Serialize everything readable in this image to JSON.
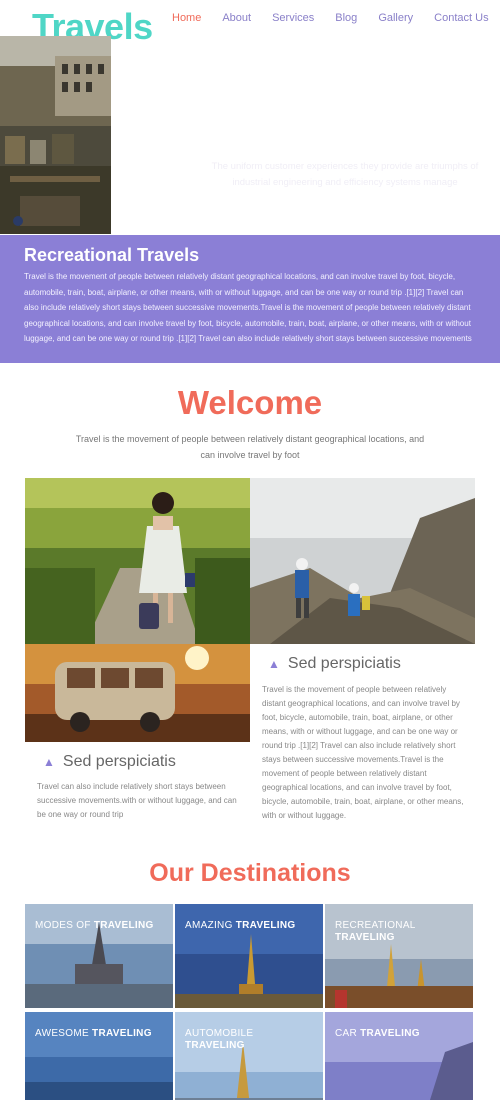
{
  "brand": {
    "logo": "Travels"
  },
  "nav": {
    "items": [
      "Home",
      "About",
      "Services",
      "Blog",
      "Gallery",
      "Contact Us"
    ],
    "active": "Home"
  },
  "hero": {
    "text": "The uniform customer experiences they provide are triumphs of industrial engineering and efficiency systems manage"
  },
  "band": {
    "title": "Recreational Travels",
    "text": "Travel is the movement of people between relatively distant geographical locations, and can involve travel by foot, bicycle, automobile, train, boat, airplane, or other means, with or without luggage, and can be one way or round trip .[1][2] Travel can also include relatively short stays between successive movements.Travel is the movement of people between relatively distant geographical locations, and can involve travel by foot, bicycle, automobile, train, boat, airplane, or other means, with or without luggage, and can be one way or round trip .[1][2] Travel can also include relatively short stays between successive movements"
  },
  "welcome": {
    "title": "Welcome",
    "text": "Travel is the movement of people between relatively distant geographical locations, and can involve travel by foot"
  },
  "features": [
    {
      "title": "Sed perspiciatis",
      "text": "Travel is the movement of people between relatively distant geographical locations, and can involve travel by foot, bicycle, automobile, train, boat, airplane, or other means, with or without luggage, and can be one way or round trip .[1][2] Travel can also include relatively short stays between successive movements.Travel is the movement of people between relatively distant geographical locations, and can involve travel by foot, bicycle, automobile, train, boat, airplane, or other means, with or without luggage."
    },
    {
      "title": "Sed perspiciatis",
      "text": "Travel can also include relatively short stays between successive movements.with or without luggage, and can be one way or round trip"
    }
  ],
  "destinations": {
    "title": "Our Destinations",
    "items": [
      {
        "pre": "MODES OF ",
        "bold": "TRAVELING"
      },
      {
        "pre": "AMAZING ",
        "bold": "TRAVELING"
      },
      {
        "pre": "RECREATIONAL ",
        "bold": "TRAVELING"
      },
      {
        "pre": "AWESOME ",
        "bold": "TRAVELING"
      },
      {
        "pre": "AUTOMOBILE ",
        "bold": "TRAVELING"
      },
      {
        "pre": "CAR ",
        "bold": "TRAVELING"
      }
    ]
  },
  "icons": {
    "feature_chevron": "chevron-up-icon"
  },
  "colors": {
    "accent": "#f06b5a",
    "brand": "#4fd6c6",
    "band": "#8b7fd6",
    "nav": "#8a80c9"
  }
}
